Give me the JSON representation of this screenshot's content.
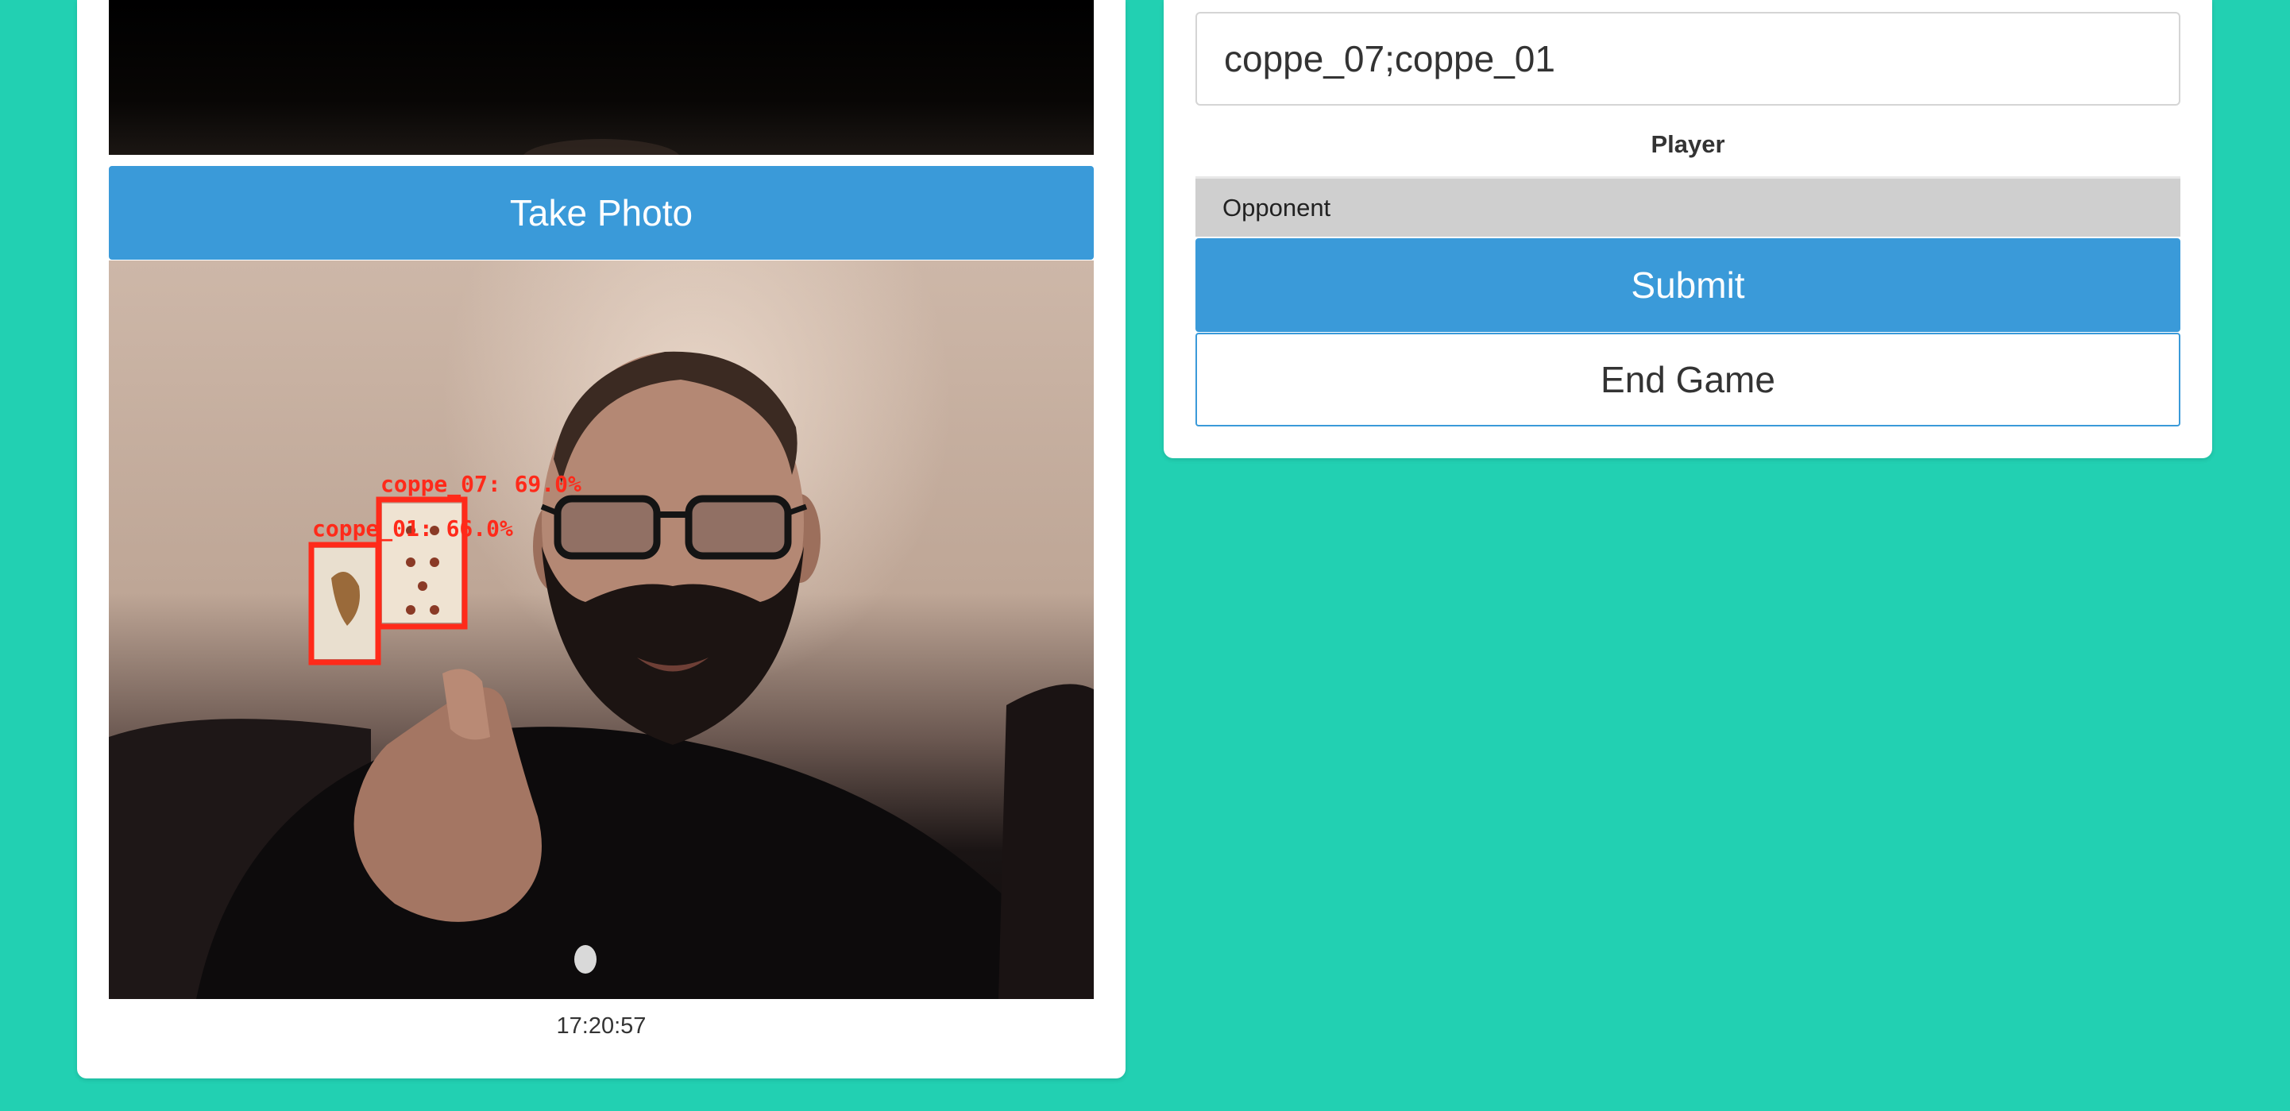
{
  "camera": {
    "take_photo_label": "Take Photo",
    "timestamp": "17:20:57"
  },
  "detections": [
    {
      "label": "coppe_07: 69.0%",
      "card": "coppe_07",
      "confidence": 69.0
    },
    {
      "label": "coppe_01: 66.0%",
      "card": "coppe_01",
      "confidence": 66.0
    }
  ],
  "form": {
    "cards_value": "coppe_07;coppe_01",
    "player_label": "Player",
    "player_selected": "Opponent",
    "submit_label": "Submit",
    "end_game_label": "End Game"
  },
  "colors": {
    "background": "#22d0b2",
    "primary": "#3a9ad9",
    "detection_box": "#ff2a1a"
  }
}
